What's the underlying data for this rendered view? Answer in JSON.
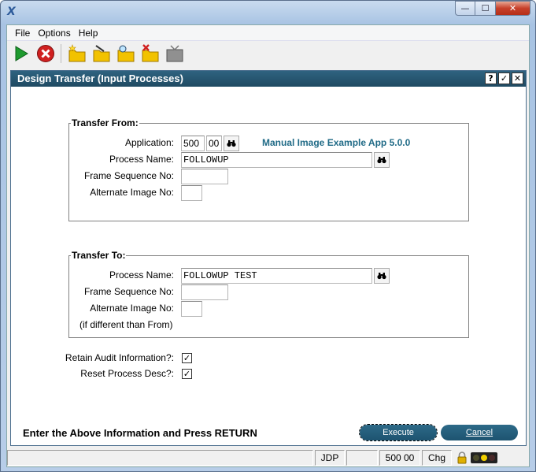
{
  "window": {
    "app_icon": "X",
    "caption": {
      "minimize": "—",
      "maximize": "☐",
      "close": "✕"
    }
  },
  "menu": {
    "items": [
      "File",
      "Options",
      "Help"
    ]
  },
  "toolbar": {
    "buttons": [
      {
        "icon": "play-icon",
        "color": "#1e9a2e"
      },
      {
        "icon": "stop-icon",
        "color": "#d02020"
      },
      {
        "icon": "new-folder-icon",
        "color": "#f2c200"
      },
      {
        "icon": "edit-folder-icon",
        "color": "#f2c200"
      },
      {
        "icon": "search-folder-icon",
        "color": "#f2c200"
      },
      {
        "icon": "delete-folder-icon",
        "color": "#f2c200"
      },
      {
        "icon": "tv-icon",
        "color": "#909090"
      }
    ]
  },
  "dialog": {
    "title": "Design Transfer (Input Processes)",
    "title_buttons": {
      "help": "?",
      "ok": "✓",
      "close": "✕"
    },
    "accent_color": "#1f4a62",
    "transfer_from": {
      "legend": "Transfer From:",
      "application_label": "Application:",
      "application_value": "500",
      "application_version": "00",
      "application_description": "Manual Image Example App 5.0.0",
      "process_name_label": "Process Name:",
      "process_name_value": "FOLLOWUP",
      "frame_sequence_label": "Frame Sequence No:",
      "frame_sequence_value": "",
      "alternate_image_label": "Alternate Image No:",
      "alternate_image_value": ""
    },
    "transfer_to": {
      "legend": "Transfer To:",
      "process_name_label": "Process Name:",
      "process_name_value": "FOLLOWUP TEST",
      "frame_sequence_label": "Frame Sequence No:",
      "frame_sequence_value": "",
      "alternate_image_label": "Alternate Image No:",
      "alternate_image_value": "",
      "note": "(if different than From)"
    },
    "options": {
      "retain_audit_label": "Retain Audit Information?:",
      "retain_audit_checked": true,
      "reset_desc_label": "Reset Process Desc?:",
      "reset_desc_checked": true,
      "check_mark": "✓"
    },
    "prompt": "Enter the Above Information and Press RETURN",
    "execute_label": "Execute",
    "cancel_label": "Cancel"
  },
  "statusbar": {
    "panels": [
      "",
      "JDP",
      "",
      "500 00",
      "Chg"
    ]
  }
}
